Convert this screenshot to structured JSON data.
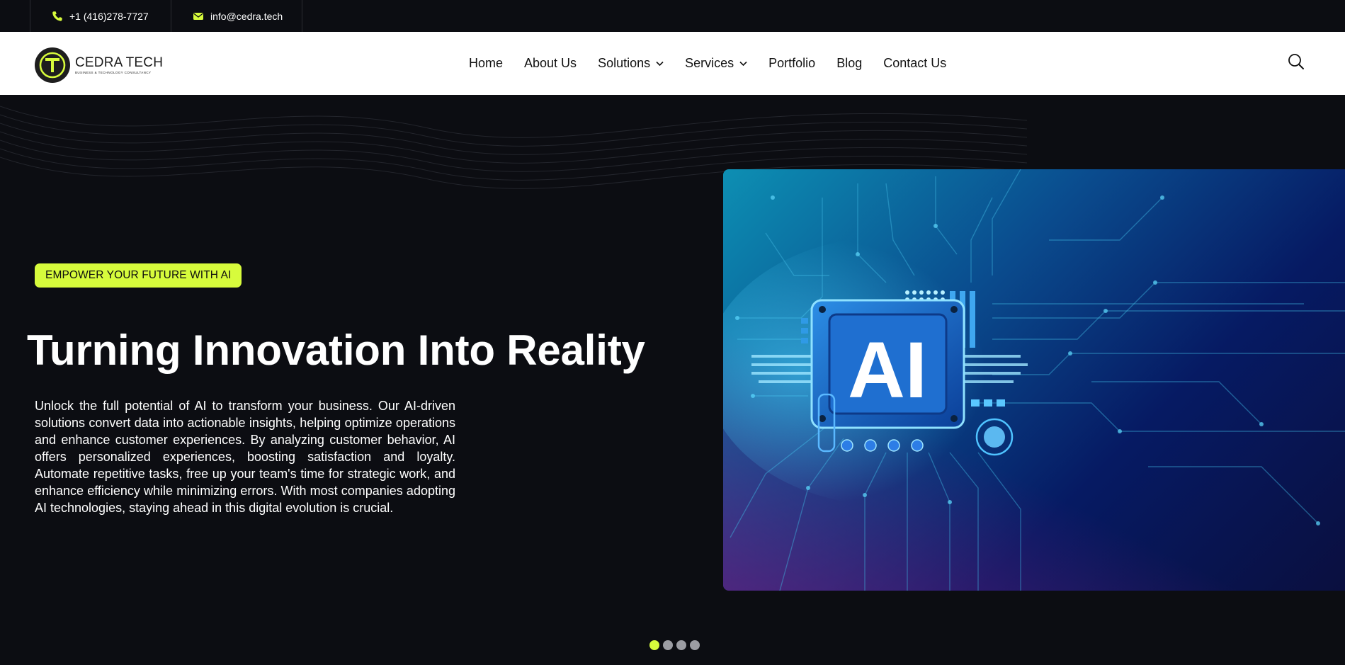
{
  "topbar": {
    "phone": "+1 (416)278-7727",
    "email": "info@cedra.tech"
  },
  "brand": {
    "name": "CEDRA TECH",
    "tagline": "BUSINESS & TECHNOLOGY CONSULTANCY",
    "logo_letter": "T"
  },
  "nav": {
    "items": [
      {
        "label": "Home",
        "has_dropdown": false
      },
      {
        "label": "About Us",
        "has_dropdown": false
      },
      {
        "label": "Solutions",
        "has_dropdown": true
      },
      {
        "label": "Services",
        "has_dropdown": true
      },
      {
        "label": "Portfolio",
        "has_dropdown": false
      },
      {
        "label": "Blog",
        "has_dropdown": false
      },
      {
        "label": "Contact Us",
        "has_dropdown": false
      }
    ]
  },
  "hero": {
    "badge": "EMPOWER YOUR FUTURE WITH AI",
    "headline": "Turning Innovation Into Reality",
    "description": "Unlock the full potential of AI to transform your business. Our AI-driven solutions convert data into actionable insights, helping optimize operations and enhance customer experiences. By analyzing customer behavior, AI offers personalized experiences, boosting satisfaction and loyalty. Automate repetitive tasks, free up your team's time for strategic work, and enhance efficiency while minimizing errors. With most companies adopting AI technologies, staying ahead in this digital evolution is crucial.",
    "image_text": "AI"
  },
  "carousel": {
    "slide_count": 4,
    "active_index": 0
  },
  "colors": {
    "accent": "#d7fb3c",
    "background": "#0c0d12",
    "nav_bg": "#ffffff",
    "text_light": "#ffffff",
    "text_dark": "#111111"
  },
  "icons": {
    "phone": "phone-icon",
    "email": "envelope-icon",
    "search": "search-icon",
    "dropdown": "chevron-down-icon"
  }
}
